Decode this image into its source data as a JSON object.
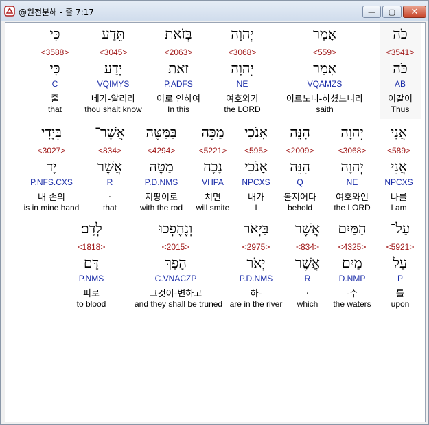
{
  "window": {
    "title": "@원전분해 - 줄 7:17",
    "minimize_glyph": "—",
    "maximize_glyph": "▢",
    "close_glyph": "✕",
    "icon": "app-logo-icon"
  },
  "rows": [
    {
      "words": [
        {
          "surface": "כֹּה",
          "strongs": "<3541>",
          "lemma": "כֹּה",
          "morph": "AB",
          "korean": "이같이",
          "english": "Thus",
          "selected": true
        },
        {
          "surface": "אָמַר",
          "strongs": "<559>",
          "lemma": "אָמַר",
          "morph": "VQAMZS",
          "korean": "이르노니-하셨느니라",
          "english": "saith"
        },
        {
          "surface": "יְהוָה",
          "strongs": "<3068>",
          "lemma": "יְהוָה",
          "morph": "NE",
          "korean": "여호와가",
          "english": "the LORD"
        },
        {
          "surface": "בְּזֹאת",
          "strongs": "<2063>",
          "lemma": "זאת",
          "morph": "P.ADFS",
          "korean": "이로 인하여",
          "english": "In this"
        },
        {
          "surface": "תֵּדַע",
          "strongs": "<3045>",
          "lemma": "יָדַע",
          "morph": "VQIMYS",
          "korean": "네가-알리라",
          "english": "thou shalt know"
        },
        {
          "surface": "כִּי",
          "strongs": "<3588>",
          "lemma": "כִּי",
          "morph": "C",
          "korean": "줄",
          "english": "that"
        }
      ]
    },
    {
      "words": [
        {
          "surface": "אֲנִי",
          "strongs": "<589>",
          "lemma": "אֲנִי",
          "morph": "NPCXS",
          "korean": "나를",
          "english": "I am"
        },
        {
          "surface": "יְהוָה",
          "strongs": "<3068>",
          "lemma": "יְהוָה",
          "morph": "NE",
          "korean": "여호와인",
          "english": "the LORD"
        },
        {
          "surface": "הִנֵּה",
          "strongs": "<2009>",
          "lemma": "הִנֵּה",
          "morph": "Q",
          "korean": "볼지어다",
          "english": "behold"
        },
        {
          "surface": "אָנֹכִי",
          "strongs": "<595>",
          "lemma": "אָנֹכִי",
          "morph": "NPCXS",
          "korean": "내가",
          "english": "I"
        },
        {
          "surface": "מַכֶּה",
          "strongs": "<5221>",
          "lemma": "נָכָה",
          "morph": "VHPA",
          "korean": "치면",
          "english": "will smite"
        },
        {
          "surface": "בַּמַּטֶּה",
          "strongs": "<4294>",
          "lemma": "מַטֶּה",
          "morph": "P.D.NMS",
          "korean": "지팡이로",
          "english": "with the rod"
        },
        {
          "surface": "אֲשֶׁר־",
          "strongs": "<834>",
          "lemma": "אֲשֶׁר",
          "morph": "R",
          "korean": ".",
          "english": "that"
        },
        {
          "surface": "בְּיָדִי",
          "strongs": "<3027>",
          "lemma": "יָד",
          "morph": "P.NFS.CXS",
          "korean": "내 손의",
          "english": "is in mine hand"
        }
      ]
    },
    {
      "words": [
        {
          "surface": "עַל־",
          "strongs": "<5921>",
          "lemma": "עַל",
          "morph": "P",
          "korean": "를",
          "english": "upon"
        },
        {
          "surface": "הַמַּיִם",
          "strongs": "<4325>",
          "lemma": "מַיִם",
          "morph": "D.NMP",
          "korean": "-수",
          "english": "the waters"
        },
        {
          "surface": "אֲשֶׁר",
          "strongs": "<834>",
          "lemma": "אֲשֶׁר",
          "morph": "R",
          "korean": ".",
          "english": "which"
        },
        {
          "surface": "בַּיְאֹר",
          "strongs": "<2975>",
          "lemma": "יְאֹר",
          "morph": "P.D.NMS",
          "korean": "하-",
          "english": "are in the river"
        },
        {
          "surface": "וְנֶהֶפְכוּ",
          "strongs": "<2015>",
          "lemma": "הָפַךְ",
          "morph": "C.VNACZP",
          "korean": "그것이-변하고",
          "english": "and they shall be truned"
        },
        {
          "surface": "לְדָם׃",
          "strongs": "<1818>",
          "lemma": "דָּם",
          "morph": "P.NMS",
          "korean": "피로",
          "english": "to blood"
        }
      ]
    }
  ]
}
